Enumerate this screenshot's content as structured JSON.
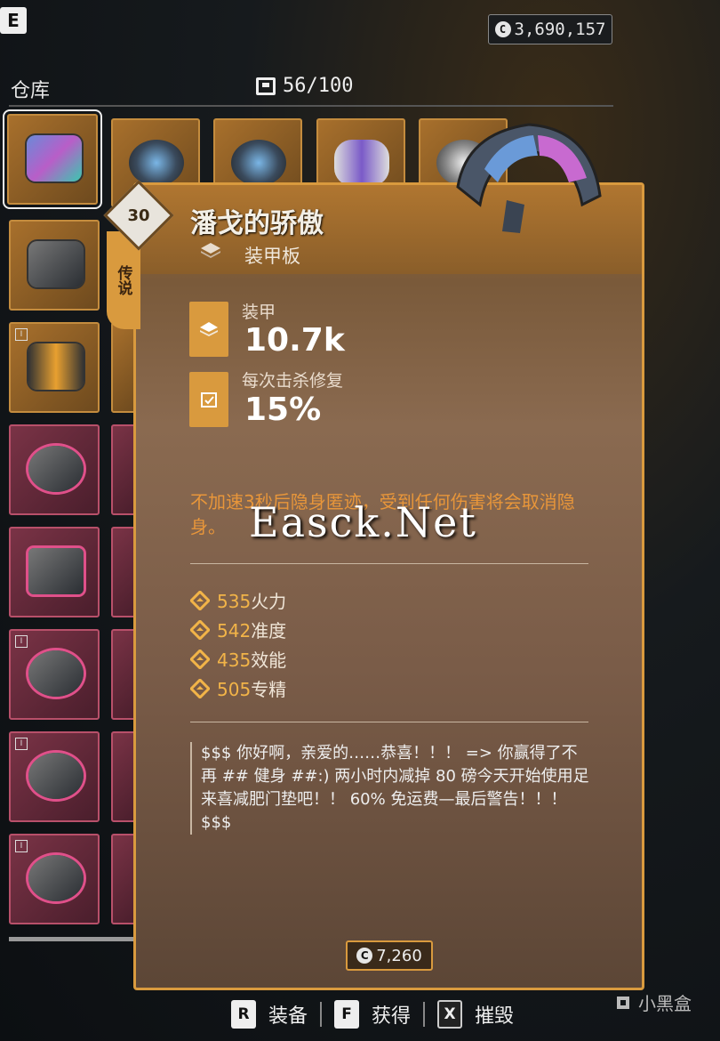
{
  "top": {
    "key_e": "E",
    "currency": "3,690,157"
  },
  "storage": {
    "label": "仓库",
    "capacity": "56/100"
  },
  "tooltip": {
    "level": "30",
    "rarity": "传说",
    "name": "潘戈的骄傲",
    "type": "装甲板",
    "stats": [
      {
        "label": "装甲",
        "value": "10.7k",
        "icon": "armor-stack-icon"
      },
      {
        "label": "每次击杀修复",
        "value": "15%",
        "icon": "repair-icon"
      }
    ],
    "description": "不加速3秒后隐身匿迹，受到任何伤害将会取消隐身。",
    "watermark": "Easck.Net",
    "attributes": [
      {
        "value": "535",
        "name": "火力"
      },
      {
        "value": "542",
        "name": "准度"
      },
      {
        "value": "435",
        "name": "效能"
      },
      {
        "value": "505",
        "name": "专精"
      }
    ],
    "flavor": "$$$ 你好啊，亲爱的……恭喜！！！ => 你赢得了不再 ## 健身 ##:) 两小时内减掉 80 磅今天开始使用足来喜减肥门垫吧！！ 60% 免运费—最后警告！！！ $$$",
    "price": "7,260"
  },
  "actions": [
    {
      "key": "R",
      "label": "装备"
    },
    {
      "key": "F",
      "label": "获得"
    },
    {
      "key": "X",
      "label": "摧毁"
    }
  ],
  "brand": "小黑盒",
  "colors": {
    "accent": "#d99a3e",
    "legendary": "#e8963a",
    "stat_value": "#f2b448"
  }
}
